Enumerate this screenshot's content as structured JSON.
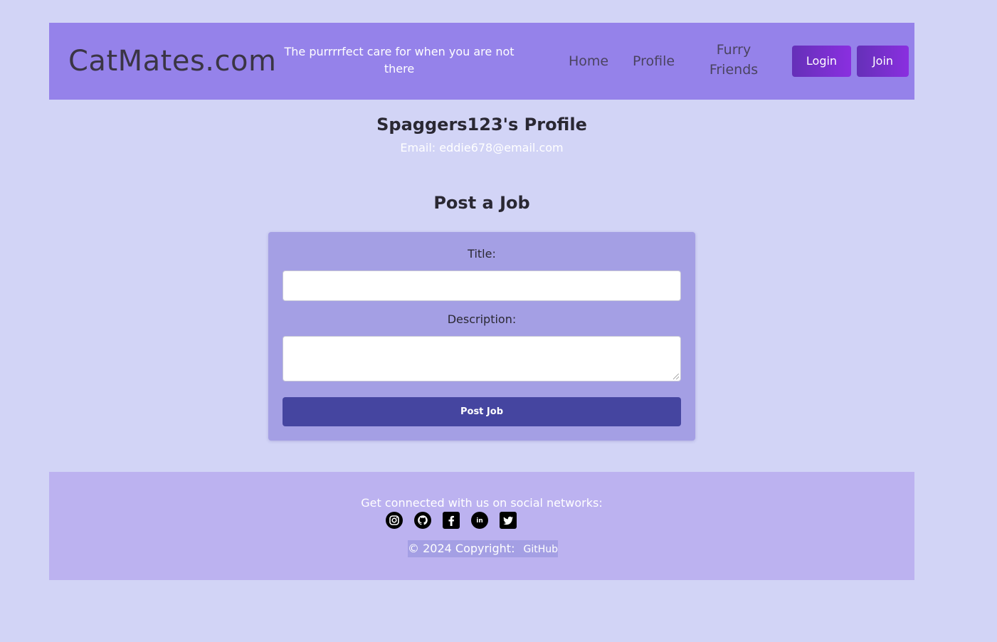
{
  "header": {
    "brand": "CatMates.com",
    "tagline": "The purrrrfect care for when you are not there",
    "nav": [
      {
        "label": "Home"
      },
      {
        "label": "Profile"
      },
      {
        "label": "Furry Friends"
      }
    ],
    "login_label": "Login",
    "join_label": "Join"
  },
  "profile": {
    "title": "Spaggers123's Profile",
    "email": "Email: eddie678@email.com"
  },
  "post_job": {
    "heading": "Post a Job",
    "title_label": "Title:",
    "title_value": "",
    "description_label": "Description:",
    "description_value": "",
    "submit_label": "Post Job"
  },
  "footer": {
    "social_text": "Get connected with us on social networks:",
    "icons": [
      "instagram-icon",
      "github-icon",
      "facebook-icon",
      "linkedin-icon",
      "twitter-icon"
    ],
    "copyright": "© 2024 Copyright:",
    "copyright_link": "GitHub"
  },
  "colors": {
    "page_bg": "#d2d4f6",
    "header_bg": "#9582ea",
    "card_bg": "#a49fe4",
    "submit_bg": "#4545a0",
    "footer_bg": "#bcb2f0",
    "button_gradient_start": "#6530b8",
    "button_gradient_end": "#8a2fe0"
  }
}
